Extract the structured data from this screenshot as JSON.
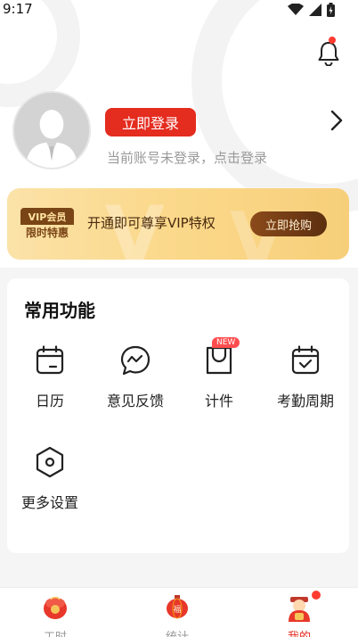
{
  "status_bar": {
    "time": "9:17"
  },
  "profile": {
    "login_button": "立即登录",
    "login_hint": "当前账号未登录，点击登录"
  },
  "vip": {
    "logo_top": "VIP会员",
    "logo_bottom": "限时特惠",
    "text": "开通即可尊享VIP特权",
    "button": "立即抢购"
  },
  "functions": {
    "title": "常用功能",
    "items": [
      {
        "label": "日历",
        "icon": "calendar-icon"
      },
      {
        "label": "意见反馈",
        "icon": "feedback-icon"
      },
      {
        "label": "计件",
        "icon": "shopping-bag-icon",
        "badge": "NEW"
      },
      {
        "label": "考勤周期",
        "icon": "calendar-check-icon"
      },
      {
        "label": "更多设置",
        "icon": "settings-hexagon-icon"
      }
    ]
  },
  "tabbar": {
    "tabs": [
      {
        "label": "工时",
        "icon": "red-envelope-icon",
        "active": false
      },
      {
        "label": "统计",
        "icon": "lantern-icon",
        "active": false
      },
      {
        "label": "我的",
        "icon": "fortune-god-icon",
        "active": true
      }
    ]
  },
  "colors": {
    "brand_red": "#e42c1f",
    "vip_gold": "#fbd98c",
    "vip_brown": "#7a4516"
  }
}
